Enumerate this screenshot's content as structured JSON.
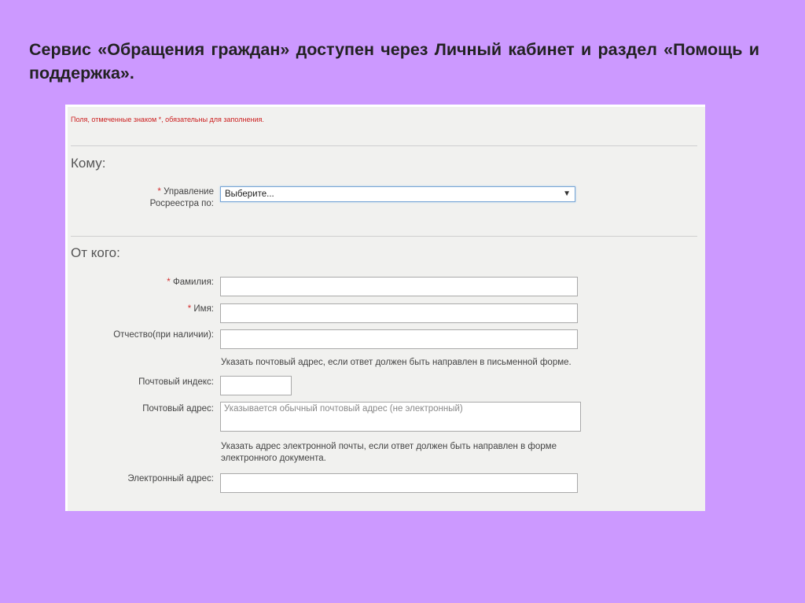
{
  "slide": {
    "title": "Сервис «Обращения граждан» доступен через Личный кабинет и раздел «Помощь и поддержка»."
  },
  "form": {
    "required_note": "Поля, отмеченные знаком *, обязательны для заполнения.",
    "to_section": {
      "title": "Кому:",
      "office_label_line1": "Управление",
      "office_label_line2": "Росреестра по:",
      "office_select_value": "Выберите...",
      "required_mark": "*"
    },
    "from_section": {
      "title": "От кого:",
      "required_mark": "*",
      "last_name_label": "Фамилия:",
      "last_name_value": "",
      "first_name_label": "Имя:",
      "first_name_value": "",
      "patronymic_label": "Отчество(при наличии):",
      "patronymic_value": "",
      "postal_hint": "Указать почтовый адрес, если ответ должен быть направлен в письменной форме.",
      "postal_index_label": "Почтовый индекс:",
      "postal_index_value": "",
      "postal_address_label": "Почтовый адрес:",
      "postal_address_placeholder": "Указывается обычный почтовый адрес (не электронный)",
      "email_hint_line1": "Указать адрес электронной почты, если ответ должен быть направлен в форме",
      "email_hint_line2": "электронного документа.",
      "email_label": "Электронный адрес:",
      "email_value": ""
    }
  },
  "icons": {
    "select_arrow": "chevron-down-icon"
  },
  "colors": {
    "slide_background": "#cc99ff",
    "form_background": "#f1f1ef",
    "required_color": "#cc1f1f"
  }
}
